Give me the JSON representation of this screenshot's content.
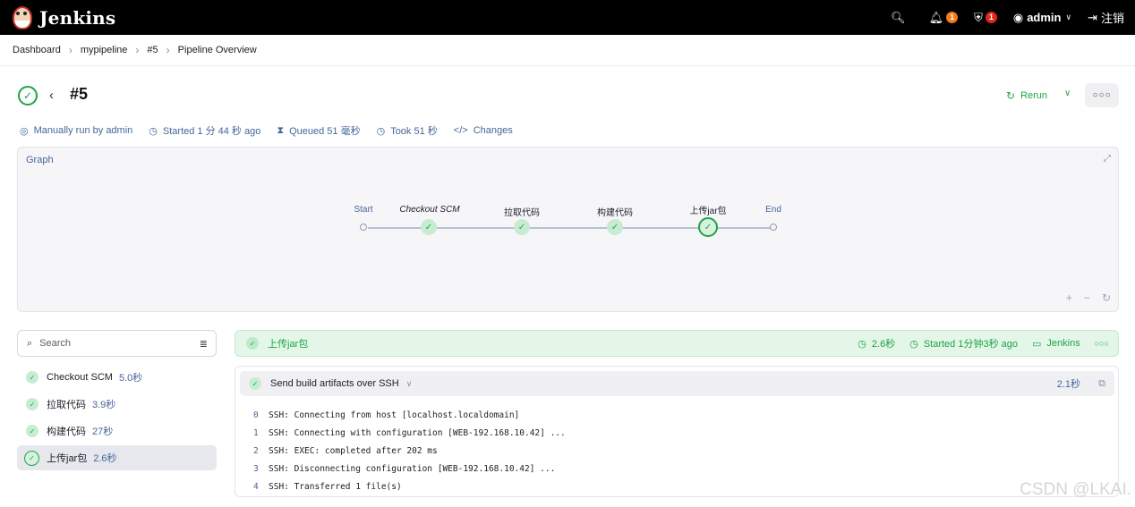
{
  "header": {
    "logo_text": "Jenkins",
    "notifications_count": "1",
    "security_count": "1",
    "user": "admin",
    "logout": "注销"
  },
  "breadcrumb": [
    "Dashboard",
    "mypipeline",
    "#5",
    "Pipeline Overview"
  ],
  "build": {
    "title": "#5",
    "rerun_label": "Rerun",
    "meta": {
      "trigger": "Manually run by admin",
      "started": "Started 1 分 44 秒 ago",
      "queued": "Queued 51 毫秒",
      "took": "Took 51 秒",
      "changes": "Changes"
    }
  },
  "graph": {
    "label": "Graph",
    "start": "Start",
    "end": "End",
    "stages": [
      "Checkout SCM",
      "拉取代码",
      "构建代码",
      "上传jar包"
    ]
  },
  "search": {
    "placeholder": "Search"
  },
  "steps": [
    {
      "name": "Checkout SCM",
      "duration": "5.0秒"
    },
    {
      "name": "拉取代码",
      "duration": "3.9秒"
    },
    {
      "name": "构建代码",
      "duration": "27秒"
    },
    {
      "name": "上传jar包",
      "duration": "2.6秒"
    }
  ],
  "stage_detail": {
    "name": "上传jar包",
    "duration": "2.6秒",
    "started": "Started 1分钟3秒 ago",
    "agent": "Jenkins",
    "step_name": "Send build artifacts over SSH",
    "step_duration": "2.1秒",
    "log": [
      {
        "n": "0",
        "text": "SSH: Connecting from host [localhost.localdomain]"
      },
      {
        "n": "1",
        "text": "SSH: Connecting with configuration [WEB-192.168.10.42] ..."
      },
      {
        "n": "2",
        "text": "SSH: EXEC: completed after 202 ms"
      },
      {
        "n": "3",
        "text": "SSH: Disconnecting configuration [WEB-192.168.10.42] ..."
      },
      {
        "n": "4",
        "text": "SSH: Transferred 1 file(s)"
      }
    ]
  },
  "watermark": "CSDN @LKAI.",
  "colors": {
    "success": "#1ea446",
    "link": "#45659b",
    "header_bg": "#000000"
  }
}
